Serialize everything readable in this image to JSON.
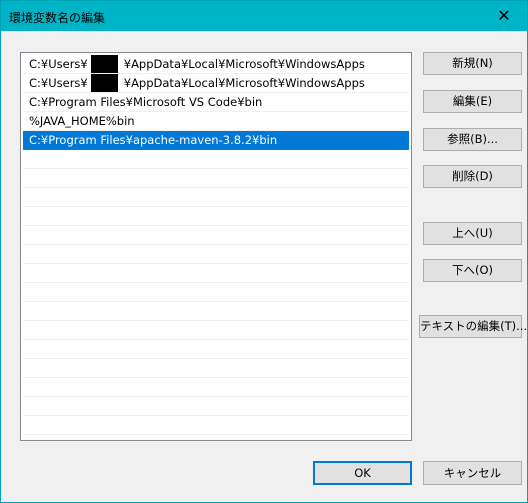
{
  "window": {
    "title": "環境変数名の編集",
    "close_glyph": "✕"
  },
  "paths": [
    "C:¥Users¥",
    "C:¥Users¥",
    "C:¥Program Files¥Microsoft VS Code¥bin",
    "%JAVA_HOME%bin",
    "C:¥Program Files¥apache-maven-3.8.2¥bin"
  ],
  "paths_tail": [
    "¥AppData¥Local¥Microsoft¥WindowsApps",
    "¥AppData¥Local¥Microsoft¥WindowsApps"
  ],
  "buttons": {
    "new": "新規(N)",
    "edit": "編集(E)",
    "browse": "参照(B)...",
    "delete": "削除(D)",
    "up": "上へ(U)",
    "down": "下へ(O)",
    "edit_text": "テキストの編集(T)...",
    "ok": "OK",
    "cancel": "キャンセル"
  }
}
